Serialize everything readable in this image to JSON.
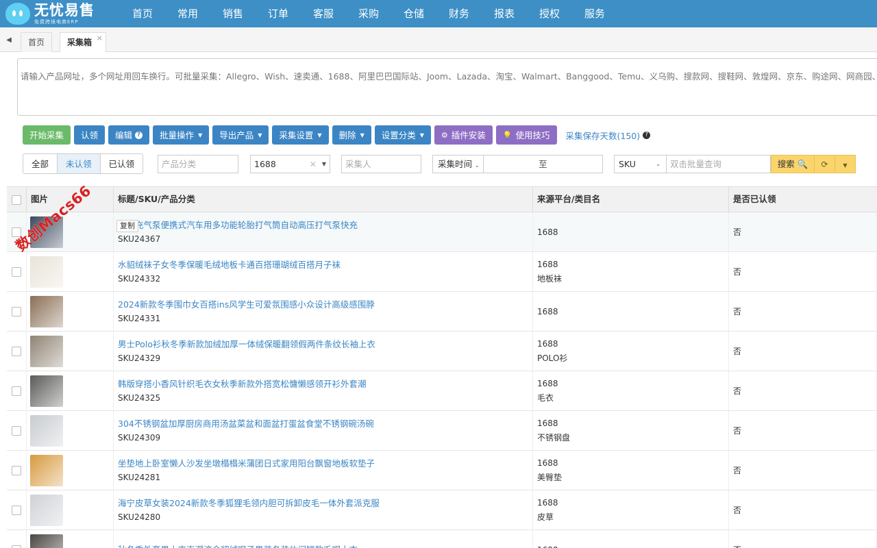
{
  "brand": {
    "title": "无忧易售",
    "subtitle": "免费跨境电商ERP"
  },
  "nav": [
    "首页",
    "常用",
    "销售",
    "订单",
    "客服",
    "采购",
    "仓储",
    "财务",
    "报表",
    "授权",
    "服务"
  ],
  "tabs": [
    {
      "label": "首页",
      "active": false
    },
    {
      "label": "采集箱",
      "active": true,
      "close": "×"
    }
  ],
  "url_input": {
    "placeholder": "请输入产品网址，多个网址用回车换行。可批量采集：Allegro、Wish、速卖通、1688、阿里巴巴国际站、Joom、Lazada、淘宝、Walmart、Banggood、Temu、义乌购、搜款网、搜鞋网、敦煌网、京东、购途网、网商园、ETSY、Onbuy、"
  },
  "toolbar": {
    "start": "开始采集",
    "claim": "认领",
    "edit": "编辑",
    "batch": "批量操作",
    "export": "导出产品",
    "settings": "采集设置",
    "delete": "删除",
    "category": "设置分类",
    "plugin": "插件安装",
    "tips": "使用技巧",
    "save_days": "采集保存天数(150)"
  },
  "filters": {
    "segments": [
      "全部",
      "未认领",
      "已认领"
    ],
    "active_segment": "未认领",
    "category_placeholder": "产品分类",
    "platform_value": "1688",
    "collector_placeholder": "采集人",
    "time_label": "采集时间",
    "range_sep": "至",
    "sku_label": "SKU",
    "batch_placeholder": "双击批量查询",
    "search_label": "搜索"
  },
  "table": {
    "headers": [
      "图片",
      "标题/SKU/产品分类",
      "来源平台/类目名",
      "是否已认领"
    ],
    "copy_label": "复制",
    "rows": [
      {
        "title": "无线充气泵便携式汽车用多功能轮胎打气筒自动高压打气泵快充",
        "sku": "SKU24367",
        "platform": "1688",
        "category": "",
        "claimed": "否",
        "thumb": "#3c4a5e"
      },
      {
        "title": "水貂绒袜子女冬季保暖毛绒地板卡通百搭珊瑚绒百搭月子袜",
        "sku": "SKU24332",
        "platform": "1688",
        "category": "地板袜",
        "claimed": "否",
        "thumb": "#e9e3d8"
      },
      {
        "title": "2024新款冬季围巾女百搭ins风学生可爱氛围感小众设计高级感围脖",
        "sku": "SKU24331",
        "platform": "1688",
        "category": "",
        "claimed": "否",
        "thumb": "#8a6e55"
      },
      {
        "title": "男士Polo衫秋冬季新款加绒加厚一体绒保暖翻领假两件条纹长袖上衣",
        "sku": "SKU24329",
        "platform": "1688",
        "category": "POLO衫",
        "claimed": "否",
        "thumb": "#8f8473"
      },
      {
        "title": "韩版穿搭小香风针织毛衣女秋季新款外搭宽松慵懒感领开衫外套潮",
        "sku": "SKU24325",
        "platform": "1688",
        "category": "毛衣",
        "claimed": "否",
        "thumb": "#5a5a58"
      },
      {
        "title": "304不锈钢盆加厚厨房商用汤盆菜盆和面盆打蛋盆食堂不锈钢碗汤碗",
        "sku": "SKU24309",
        "platform": "1688",
        "category": "不锈钢盘",
        "claimed": "否",
        "thumb": "#c8ccd0"
      },
      {
        "title": "坐垫地上卧室懒人沙发坐墩榻榻米蒲团日式家用阳台飘窗地板软垫子",
        "sku": "SKU24281",
        "platform": "1688",
        "category": "美臀垫",
        "claimed": "否",
        "thumb": "#d79a3f"
      },
      {
        "title": "海宁皮草女装2024新款冬季狐狸毛领内胆可拆卸皮毛一体外套派克服",
        "sku": "SKU24280",
        "platform": "1688",
        "category": "皮草",
        "claimed": "否",
        "thumb": "#cfd1d6"
      },
      {
        "title": "秋冬季外套男士夹克潮流金貂绒呢子男装冬装休闲短款毛呢大衣",
        "sku": "",
        "platform": "1688",
        "category": "",
        "claimed": "否",
        "thumb": "#4a4640"
      }
    ]
  },
  "watermark": "数创Macs66",
  "colors": {
    "topbar": "#3d8fc6",
    "primary": "#3b85c4",
    "green": "#6aba6a",
    "purple": "#8e6ec4",
    "yellow": "#f9d56c"
  }
}
